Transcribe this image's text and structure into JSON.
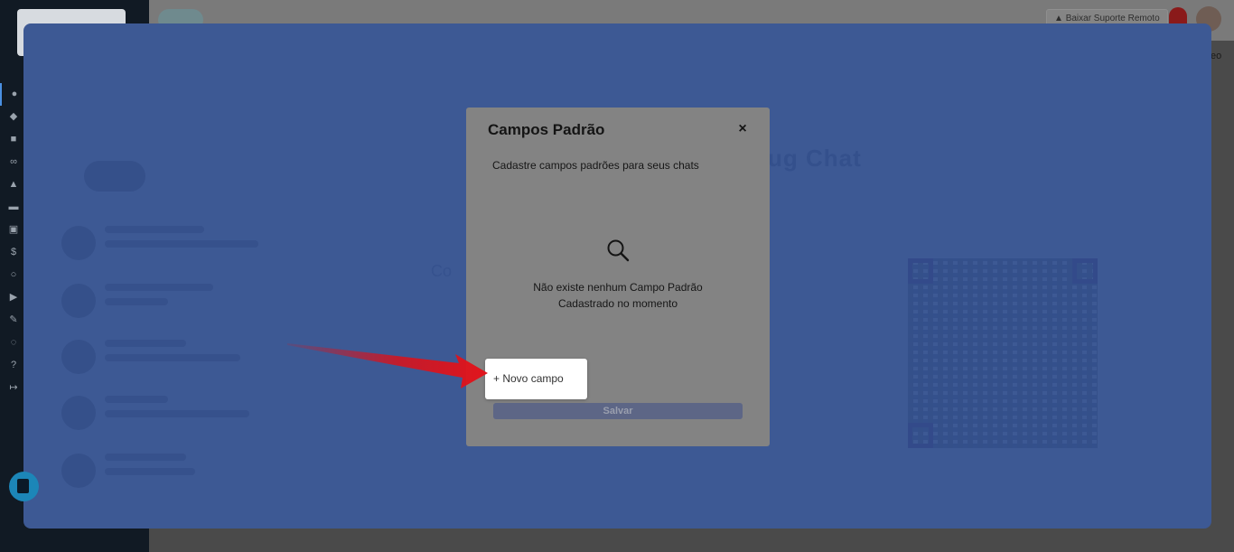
{
  "topbar": {
    "remote_support_label": "Baixar Suporte Remoto",
    "edge_text": "eo"
  },
  "background": {
    "ghost_title": "ug Chat",
    "ghost_heading": "Co"
  },
  "modal": {
    "title": "Campos Padrão",
    "close_icon": "×",
    "subtitle": "Cadastre campos padrões para seus chats",
    "empty_line1": "Não existe nenhum Campo Padrão",
    "empty_line2": "Cadastrado no momento",
    "new_field_label": "+ Novo campo",
    "save_label": "Salvar"
  },
  "colors": {
    "overlay": "#3d5994",
    "modal_bg": "#838383",
    "arrow": "#d9121b",
    "save_button": "#5d6686"
  },
  "icons": [
    "search-icon",
    "close-icon",
    "arrow-annotation",
    "chat-launcher-icon",
    "notification-bell-icon"
  ]
}
